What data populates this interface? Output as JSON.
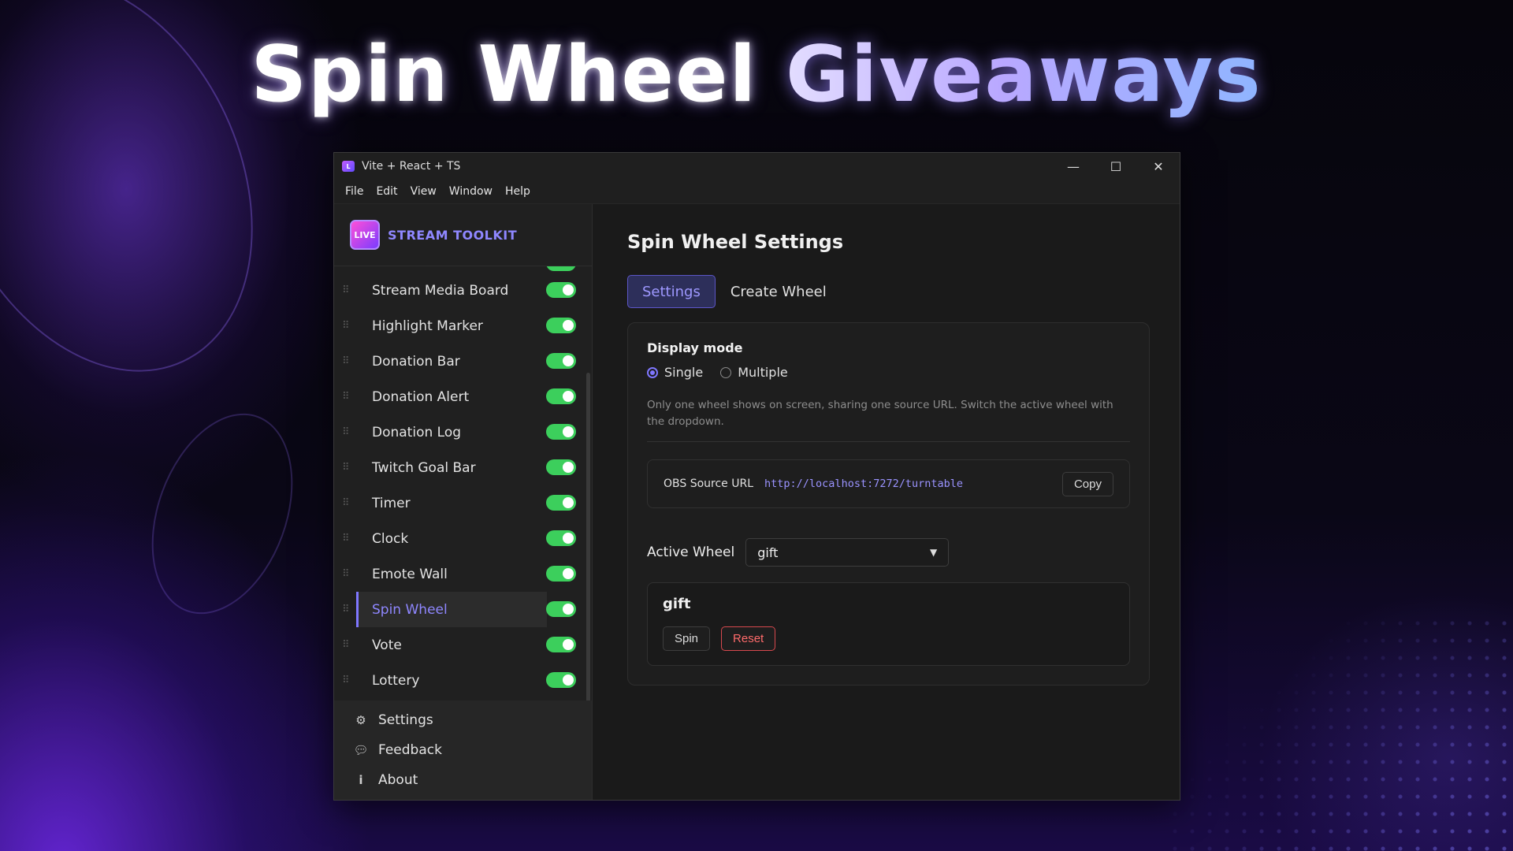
{
  "hero": {
    "title_part1": "Spin Wheel",
    "title_part2": "Giveaways"
  },
  "window": {
    "title": "Vite + React + TS",
    "controls": {
      "minimize": "—",
      "maximize": "☐",
      "close": "✕"
    }
  },
  "menu": [
    "File",
    "Edit",
    "View",
    "Window",
    "Help"
  ],
  "sidebar": {
    "brand": "STREAM TOOLKIT",
    "logo_text": "LIVE",
    "modules": [
      {
        "label": "Stream Media Board",
        "enabled": true
      },
      {
        "label": "Highlight Marker",
        "enabled": true
      },
      {
        "label": "Donation Bar",
        "enabled": true
      },
      {
        "label": "Donation Alert",
        "enabled": true
      },
      {
        "label": "Donation Log",
        "enabled": true
      },
      {
        "label": "Twitch Goal Bar",
        "enabled": true
      },
      {
        "label": "Timer",
        "enabled": true
      },
      {
        "label": "Clock",
        "enabled": true
      },
      {
        "label": "Emote Wall",
        "enabled": true
      },
      {
        "label": "Spin Wheel",
        "enabled": true,
        "active": true
      },
      {
        "label": "Vote",
        "enabled": true
      },
      {
        "label": "Lottery",
        "enabled": true
      }
    ],
    "footer": [
      {
        "label": "Settings",
        "icon": "gear-icon"
      },
      {
        "label": "Feedback",
        "icon": "chat-bubble-icon"
      },
      {
        "label": "About",
        "icon": "info-icon"
      }
    ]
  },
  "main": {
    "title": "Spin Wheel Settings",
    "tabs": [
      {
        "label": "Settings",
        "active": true
      },
      {
        "label": "Create Wheel",
        "active": false
      }
    ],
    "display_mode": {
      "label": "Display mode",
      "options": [
        {
          "label": "Single",
          "selected": true
        },
        {
          "label": "Multiple",
          "selected": false
        }
      ],
      "help": "Only one wheel shows on screen, sharing one source URL. Switch the active wheel with the dropdown."
    },
    "obs": {
      "label": "OBS Source URL",
      "url": "http://localhost:7272/turntable",
      "copy": "Copy"
    },
    "active_wheel": {
      "label": "Active Wheel",
      "value": "gift"
    },
    "wheel": {
      "name": "gift",
      "spin": "Spin",
      "reset": "Reset"
    }
  },
  "colors": {
    "accent": "#7f77ff",
    "toggle_on": "#3ccf5c",
    "danger": "#d8494e"
  }
}
